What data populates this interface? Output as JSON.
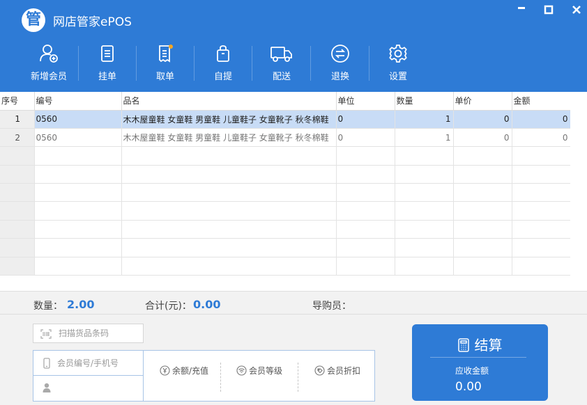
{
  "app": {
    "title": "网店管家ePOS",
    "logo_char": "管"
  },
  "window_controls": {
    "minimize": "▀",
    "maximize": "▢",
    "close": "✕"
  },
  "toolbar": [
    {
      "label": "新增会员",
      "icon": "add-member-icon"
    },
    {
      "label": "挂单",
      "icon": "hold-order-icon"
    },
    {
      "label": "取单",
      "icon": "retrieve-order-icon"
    },
    {
      "label": "自提",
      "icon": "pickup-bag-icon"
    },
    {
      "label": "配送",
      "icon": "delivery-truck-icon"
    },
    {
      "label": "退换",
      "icon": "return-exchange-icon"
    },
    {
      "label": "设置",
      "icon": "settings-gear-icon"
    }
  ],
  "table": {
    "columns": [
      "序号",
      "编号",
      "品名",
      "单位",
      "数量",
      "单价",
      "金额"
    ],
    "rows": [
      {
        "seq": "1",
        "code": "0560",
        "name": "木木屋童鞋 女童鞋 男童鞋 儿童鞋子 女童靴子 秋冬棉鞋",
        "unit": "0",
        "qty": "1",
        "price": "0",
        "amount": "0",
        "selected": true
      },
      {
        "seq": "2",
        "code": "0560",
        "name": "木木屋童鞋 女童鞋 男童鞋 儿童鞋子 女童靴子 秋冬棉鞋",
        "unit": "0",
        "qty": "1",
        "price": "0",
        "amount": "0",
        "selected": false
      }
    ],
    "empty_rows": 7
  },
  "summary": {
    "qty_label": "数量：",
    "qty_value": "2.00",
    "total_label": "合计(元)：",
    "total_value": "0.00",
    "guide_label": "导购员："
  },
  "scan": {
    "placeholder": "扫描货品条码"
  },
  "member": {
    "id_placeholder": "会员编号/手机号",
    "actions": [
      {
        "label": "余额/充值",
        "icon": "yen-coin-icon"
      },
      {
        "label": "会员等级",
        "icon": "member-level-icon"
      },
      {
        "label": "会员折扣",
        "icon": "discount-tag-icon"
      }
    ]
  },
  "checkout": {
    "label": "结算",
    "due_label": "应收金额",
    "due_value": "0.00"
  },
  "colors": {
    "primary": "#2e7bd6",
    "selected_row": "#c8dcf6",
    "panel_bg": "#f2f2f2"
  }
}
